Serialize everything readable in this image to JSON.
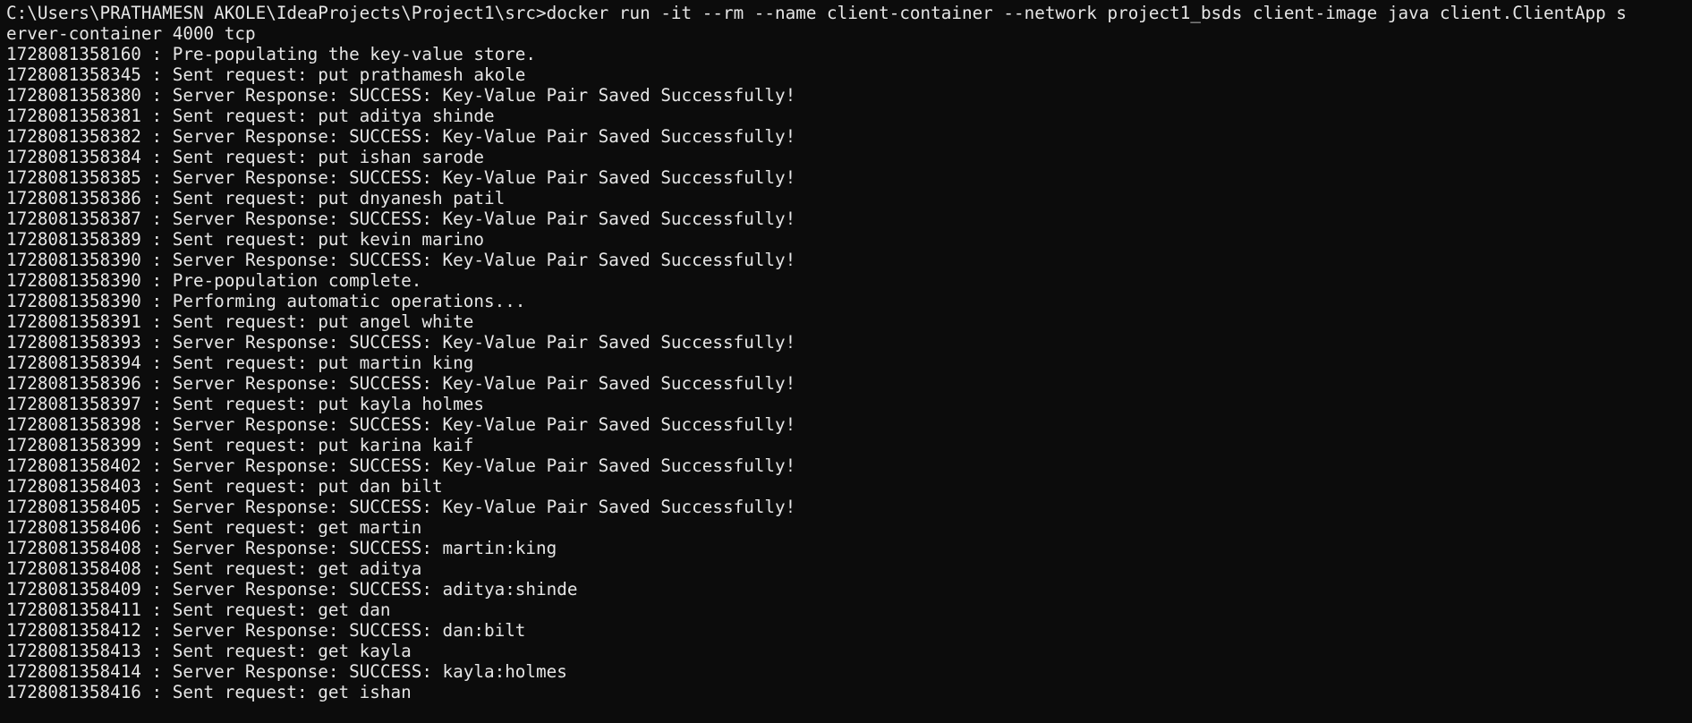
{
  "terminal": {
    "command_line_1": "C:\\Users\\PRATHAMESN AKOLE\\IdeaProjects\\Project1\\src>docker run -it --rm --name client-container --network project1_bsds client-image java client.ClientApp s",
    "command_line_2": "erver-container 4000 tcp",
    "output_lines": [
      "1728081358160 : Pre-populating the key-value store.",
      "1728081358345 : Sent request: put prathamesh akole",
      "1728081358380 : Server Response: SUCCESS: Key-Value Pair Saved Successfully!",
      "1728081358381 : Sent request: put aditya shinde",
      "1728081358382 : Server Response: SUCCESS: Key-Value Pair Saved Successfully!",
      "1728081358384 : Sent request: put ishan sarode",
      "1728081358385 : Server Response: SUCCESS: Key-Value Pair Saved Successfully!",
      "1728081358386 : Sent request: put dnyanesh patil",
      "1728081358387 : Server Response: SUCCESS: Key-Value Pair Saved Successfully!",
      "1728081358389 : Sent request: put kevin marino",
      "1728081358390 : Server Response: SUCCESS: Key-Value Pair Saved Successfully!",
      "1728081358390 : Pre-population complete.",
      "1728081358390 : Performing automatic operations...",
      "1728081358391 : Sent request: put angel white",
      "1728081358393 : Server Response: SUCCESS: Key-Value Pair Saved Successfully!",
      "1728081358394 : Sent request: put martin king",
      "1728081358396 : Server Response: SUCCESS: Key-Value Pair Saved Successfully!",
      "1728081358397 : Sent request: put kayla holmes",
      "1728081358398 : Server Response: SUCCESS: Key-Value Pair Saved Successfully!",
      "1728081358399 : Sent request: put karina kaif",
      "1728081358402 : Server Response: SUCCESS: Key-Value Pair Saved Successfully!",
      "1728081358403 : Sent request: put dan bilt",
      "1728081358405 : Server Response: SUCCESS: Key-Value Pair Saved Successfully!",
      "1728081358406 : Sent request: get martin",
      "1728081358408 : Server Response: SUCCESS: martin:king",
      "1728081358408 : Sent request: get aditya",
      "1728081358409 : Server Response: SUCCESS: aditya:shinde",
      "1728081358411 : Sent request: get dan",
      "1728081358412 : Server Response: SUCCESS: dan:bilt",
      "1728081358413 : Sent request: get kayla",
      "1728081358414 : Server Response: SUCCESS: kayla:holmes",
      "1728081358416 : Sent request: get ishan"
    ]
  }
}
